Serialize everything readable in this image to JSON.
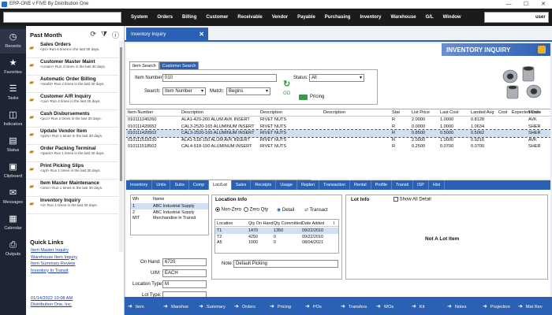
{
  "window": {
    "title": "ERP-ONE v FIVE By Distribution One",
    "minimize": "—",
    "maximize": "☐",
    "close": "✕"
  },
  "menubar": {
    "items": [
      "System",
      "Orders",
      "Billing",
      "Customer",
      "Receivable",
      "Vendor",
      "Payable",
      "Purchasing",
      "Inventory",
      "Warehouse",
      "G/L",
      "Window"
    ],
    "user": "user"
  },
  "leftnav": {
    "items": [
      {
        "label": "Recents",
        "icon": "clock-icon"
      },
      {
        "label": "Favorites",
        "icon": "star-icon"
      },
      {
        "label": "Tasks",
        "icon": "tasks-icon"
      },
      {
        "label": "Indicators",
        "icon": "indicators-icon"
      },
      {
        "label": "Status",
        "icon": "status-icon"
      },
      {
        "label": "Clipboard",
        "icon": "clipboard-icon"
      },
      {
        "label": "Messages",
        "icon": "messages-icon"
      },
      {
        "label": "Calendar",
        "icon": "calendar-icon"
      },
      {
        "label": "Outputs",
        "icon": "outputs-icon"
      }
    ]
  },
  "panel": {
    "header": "Past Month",
    "recents": [
      {
        "name": "Sales Orders",
        "desc": "<ps> Run 6 times in the last 30 days."
      },
      {
        "name": "Customer Master Maint",
        "desc": "<cmain> Run 4 times in the last 30 days."
      },
      {
        "name": "Automatic Order Billing",
        "desc": "<seabl> Run 2 times in the last 30 days."
      },
      {
        "name": "Customer A/R Inquiry",
        "desc": "<cai> Run 4 times in the last 30 days."
      },
      {
        "name": "Cash Disbursements",
        "desc": "<pcc> Run 2 times in the last 30 days."
      },
      {
        "name": "Update Vendor Item",
        "desc": "<pvin> Run 1 times in the last 30 days."
      },
      {
        "name": "Order Packing Terminal",
        "desc": "<tpack> Run 1 times in the last 30 days."
      },
      {
        "name": "Print Picking Slips",
        "desc": "<opl> Run 1 times in the last 30 days."
      },
      {
        "name": "Item Master Maintenance",
        "desc": "<imin> Run 1 times in the last 30 days."
      },
      {
        "name": "Inventory Inquiry",
        "desc": "<ii> Run 1 times in the last 30 days."
      }
    ],
    "quicklinks_header": "Quick Links",
    "quicklinks": [
      "Item Master Inquiry",
      "Warehouse Item Inquiry",
      "Item Summary Review",
      "Inventory In Transit"
    ],
    "footer_date": "01/14/2022  10:08 AM",
    "footer_company": "Distribution One, Inc."
  },
  "main": {
    "tab_label": "Inventory Inquiry",
    "banner": "INVENTORY INQUIRY",
    "subtabs": [
      "Item Search",
      "Customer Search"
    ],
    "item_number_label": "Item Number",
    "item_number_value": "010",
    "search_label": "Search:",
    "search_value": "Item Number",
    "match_label": "Match:",
    "match_value": "Begins",
    "status_label": "Status:",
    "status_value": "All",
    "go_label": "GO",
    "pricing_label": "Pricing",
    "grid_headers": [
      "Item Number",
      "Description",
      "Description",
      "Description",
      "Stat",
      "List Price",
      "Last Cost",
      "Landed Avg",
      "Cost",
      "Expected Date",
      "Vendo"
    ],
    "grid_rows": [
      [
        "010111240260",
        "ALA1-420-260 ALUM AVK INSERT",
        "RIVET NUTS",
        "",
        "R",
        "2.0000",
        "1.0000",
        "0.8128",
        "",
        "",
        "AVK"
      ],
      [
        "010111420652",
        "CAL3-2520-165 ALUMINUM INSERT",
        "RIVET NUTS",
        "",
        "R",
        "0.0000",
        "1.0000",
        "1.0634",
        "",
        "",
        "SHER"
      ],
      [
        "010111420502",
        "CAL3-2520-165 ALUMINUM INSERT",
        "RIVET NUTS",
        "",
        "R",
        "0.8500",
        "0.5000",
        "0.5062",
        "",
        "",
        "SHER"
      ],
      [
        "010111518150",
        "ALA1-518-150 ALUM AVK INSERT",
        "RIVET NUTS",
        "",
        "R",
        "2.0000",
        "1.0000",
        "0.9216",
        "",
        "",
        "AVK"
      ],
      [
        "010111518502",
        "CAL4-518-150 ALUMINUM INSERT",
        "RIVET NUTS",
        "",
        "R",
        "0.2500",
        "0.0700",
        "0.0700",
        "",
        "",
        "SHER"
      ]
    ],
    "bottom_tabs": [
      "Inventory",
      "Units",
      "Subs",
      "Comp",
      "Loc/Lot",
      "Sales",
      "Receipts",
      "Usage",
      "Replen",
      "Transaction",
      "Rental",
      "Profile",
      "Transit",
      "ISP",
      "Hist"
    ],
    "wh_headers": [
      "Wh",
      "Name"
    ],
    "wh_rows": [
      [
        "1",
        "ABC Industrial Supply"
      ],
      [
        "2",
        "ABC Industrial Supply"
      ],
      [
        "MIT",
        "Merchandise in Transit"
      ]
    ],
    "on_hand_label": "On Hand:",
    "on_hand_value": "6720",
    "um_label": "U/M:",
    "um_value": "EACH",
    "loctype_label": "Location Type:",
    "loctype_value": "M",
    "lottype_label": "Lot Type:",
    "lottype_value": "",
    "locinfo_title": "Location Info",
    "nonzero_label": "Non-Zero",
    "zeroqty_label": "Zero Qty",
    "detail_label": "Detail",
    "transact_label": "Transact",
    "loc_headers": [
      "Location",
      "Qty On Hand",
      "Qty Committed",
      "Date Added",
      "I"
    ],
    "loc_rows": [
      [
        "T1",
        "1470",
        "1350",
        "09/22/2010",
        ""
      ],
      [
        "T2",
        "4250",
        "0",
        "09/22/2010",
        ""
      ],
      [
        "A5",
        "1000",
        "0",
        "08/04/2021",
        ""
      ]
    ],
    "note_label": "Note:",
    "note_value": "Default Picking",
    "lotinfo_title": "Lot Info",
    "show_all_label": "Show All Detail",
    "not_lot": "Not A Lot Item",
    "actions": [
      "Item",
      "Warehse",
      "Summary",
      "Orders",
      "Pricing",
      "POs",
      "Transfers",
      "WOs",
      "Kit",
      "Notes",
      "Projection",
      "Mat Rev"
    ]
  },
  "colors": {
    "accent": "#2b61b4",
    "nav": "#1d2433",
    "menubar": "#1b1b1b"
  }
}
